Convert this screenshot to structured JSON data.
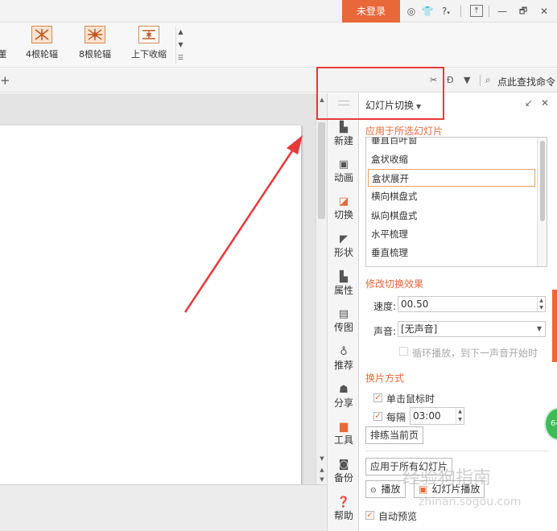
{
  "titlebar": {
    "login_label": "未登录",
    "icons": [
      "shirt-icon",
      "help-icon",
      "upload-icon",
      "minimize-icon",
      "restore-icon",
      "close-icon"
    ],
    "help_label": "?",
    "minimize_label": "—",
    "restore_label": "🗗",
    "close_label": "✕"
  },
  "ribbon": {
    "effects": [
      {
        "label": "菫",
        "icon": "effect-thumb-icon"
      },
      {
        "label": "4根轮辐",
        "icon": "wheel4-icon"
      },
      {
        "label": "8根轮辐",
        "icon": "wheel8-icon"
      },
      {
        "label": "上下收缩",
        "icon": "shrink-icon"
      }
    ]
  },
  "tabbar": {
    "plus": "+",
    "search_label": "点此查找命令"
  },
  "rail": {
    "items": [
      {
        "label": "新建",
        "icon": "new-file-icon"
      },
      {
        "label": "动画",
        "icon": "animation-icon"
      },
      {
        "label": "切换",
        "icon": "switch-icon"
      },
      {
        "label": "形状",
        "icon": "shape-icon"
      },
      {
        "label": "属性",
        "icon": "property-icon"
      },
      {
        "label": "传图",
        "icon": "upload-image-icon"
      },
      {
        "label": "推荐",
        "icon": "recommend-icon"
      },
      {
        "label": "分享",
        "icon": "share-icon"
      },
      {
        "label": "工具",
        "icon": "toolbox-icon"
      },
      {
        "label": "备份",
        "icon": "backup-icon"
      },
      {
        "label": "帮助",
        "icon": "help-circle-icon"
      }
    ]
  },
  "pane": {
    "title": "幻灯片切换",
    "apply_header": "应用于所选幻灯片",
    "transitions": [
      "垂直百叶窗",
      "盒状收缩",
      "盒状展开",
      "横向棋盘式",
      "纵向棋盘式",
      "水平梳理",
      "垂直梳理"
    ],
    "selected_transition": "盒状展开",
    "modify_header": "修改切换效果",
    "speed_label": "速度:",
    "speed_value": "00.50",
    "sound_label": "声音:",
    "sound_value": "[无声音]",
    "loop_label": "循环播放，到下一声音开始时",
    "switch_header": "换片方式",
    "on_click_label": "单击鼠标时",
    "every_label": "每隔",
    "every_value": "03:00",
    "rehearse_label": "排练当前页",
    "apply_all_label": "应用于所有幻灯片",
    "play_label": "播放",
    "slideshow_label": "幻灯片播放",
    "autopreview_label": "自动预览"
  },
  "decor": {
    "badge": "64",
    "watermark_cn": "经验狗指南",
    "watermark_en": "zhinan.sogou.com"
  },
  "colors": {
    "accent": "#e8683a",
    "annotation_red": "#e8393a",
    "badge_green": "#3dbb57"
  }
}
